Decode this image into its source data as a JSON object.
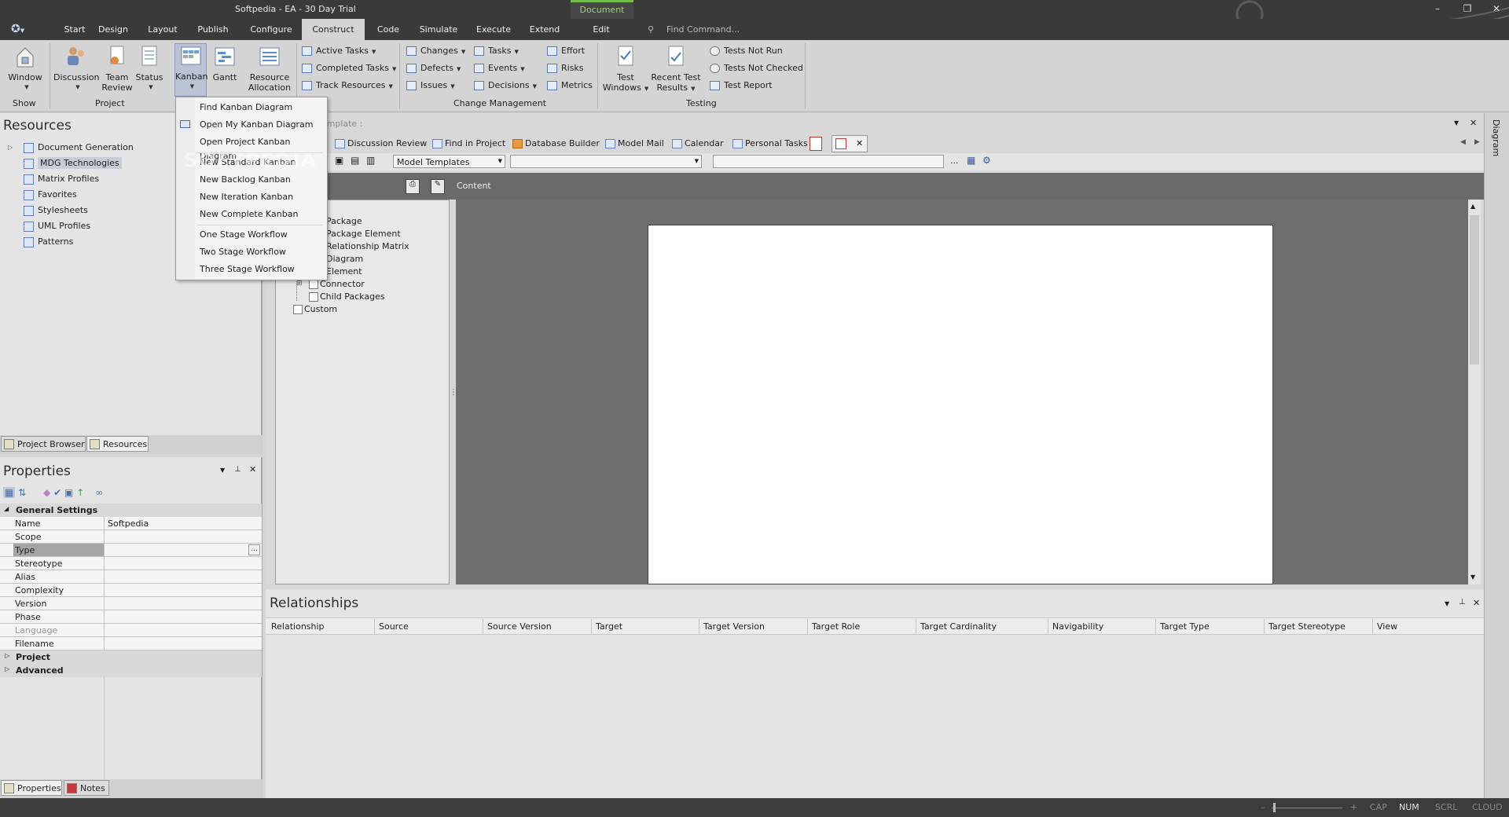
{
  "window": {
    "title": "Softpedia - EA - 30 Day Trial",
    "context_tab": "Document",
    "minimize": "–",
    "restore": "❐",
    "close": "✕"
  },
  "menu_tabs": [
    "Start",
    "Design",
    "Layout",
    "Publish",
    "Configure",
    "Construct",
    "Code",
    "Simulate",
    "Execute",
    "Extend",
    "Edit"
  ],
  "find_command": "Find Command...",
  "ribbon": {
    "show": {
      "window": "Window",
      "group": "Show"
    },
    "project": {
      "discussion": "Discussion",
      "team_review_1": "Team",
      "team_review_2": "Review",
      "status": "Status",
      "kanban": "Kanban",
      "gantt": "Gantt",
      "resource_1": "Resource",
      "resource_2": "Allocation",
      "group": "Project"
    },
    "tasks_col": [
      "Active Tasks",
      "Completed Tasks",
      "Track Resources"
    ],
    "change_col1": [
      "Changes",
      "Defects",
      "Issues"
    ],
    "change_col2": [
      "Tasks",
      "Events",
      "Decisions"
    ],
    "change_col3": [
      "Effort",
      "Risks",
      "Metrics"
    ],
    "change_group": "Change Management",
    "testing": {
      "test_windows_1": "Test",
      "test_windows_2": "Windows",
      "recent_1": "Recent Test",
      "recent_2": "Results",
      "tests_not_run": "Tests Not Run",
      "tests_not_checked": "Tests Not Checked",
      "test_report": "Test Report",
      "group": "Testing"
    }
  },
  "kanban_menu": [
    "Find Kanban Diagram",
    "Open My Kanban Diagram",
    "Open Project Kanban Diagram",
    "New Standard Kanban",
    "New Backlog Kanban",
    "New Iteration Kanban",
    "New Complete Kanban",
    "One Stage Workflow",
    "Two Stage Workflow",
    "Three Stage Workflow"
  ],
  "resources": {
    "title": "Resources",
    "items": [
      "Document Generation",
      "MDG Technologies",
      "Matrix Profiles",
      "Favorites",
      "Stylesheets",
      "UML Profiles",
      "Patterns"
    ],
    "tabs": [
      "Project Browser",
      "Resources"
    ]
  },
  "properties": {
    "title": "Properties",
    "general": "General Settings",
    "rows": [
      [
        "Name",
        "Softpedia"
      ],
      [
        "Scope",
        ""
      ],
      [
        "Type",
        ""
      ],
      [
        "Stereotype",
        ""
      ],
      [
        "Alias",
        ""
      ],
      [
        "Complexity",
        ""
      ],
      [
        "Version",
        ""
      ],
      [
        "Phase",
        ""
      ],
      [
        "Language",
        ""
      ],
      [
        "Filename",
        ""
      ]
    ],
    "project": "Project",
    "advanced": "Advanced",
    "tabs": [
      "Properties",
      "Notes"
    ],
    "ellipsis": "..."
  },
  "editor": {
    "template_label": "Template :",
    "doc_tabs": [
      "Discussion Review",
      "Find in Project",
      "Database Builder",
      "Model Mail",
      "Calendar",
      "Personal Tasks"
    ],
    "model_templates": "Model Templates",
    "content": "Content",
    "ellipsis": "...",
    "tree": [
      "Package",
      "Package Element",
      "Relationship Matrix",
      "Diagram",
      "Element",
      "Connector",
      "Child Packages",
      "Custom"
    ],
    "side_label": "Diagram"
  },
  "relationships": {
    "title": "Relationships",
    "columns": [
      "Relationship",
      "Source",
      "Source Version",
      "Target",
      "Target Version",
      "Target Role",
      "Target Cardinality",
      "Navigability",
      "Target Type",
      "Target Stereotype",
      "View"
    ]
  },
  "status": {
    "caps": "CAP",
    "num": "NUM",
    "scrl": "SCRL",
    "cloud": "CLOUD",
    "zoom_minus": "–",
    "zoom_plus": "+"
  },
  "watermark": "SOFTPEDIA"
}
